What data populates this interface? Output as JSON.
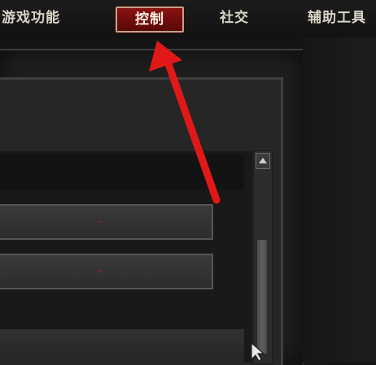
{
  "tabs": [
    {
      "label": "游戏功能"
    },
    {
      "label": "控制"
    },
    {
      "label": "社交"
    },
    {
      "label": "辅助工具"
    }
  ],
  "fields": [
    {
      "value": "–"
    },
    {
      "value": "–"
    }
  ],
  "icons": {
    "scroll_up": "triangle-up-icon",
    "annotation_arrow": "red-arrow-icon",
    "cursor": "pointer-cursor-icon"
  },
  "colors": {
    "active_tab": "#7a1010",
    "arrow": "#e01818",
    "text": "#d9d4c8",
    "background": "#141414"
  }
}
